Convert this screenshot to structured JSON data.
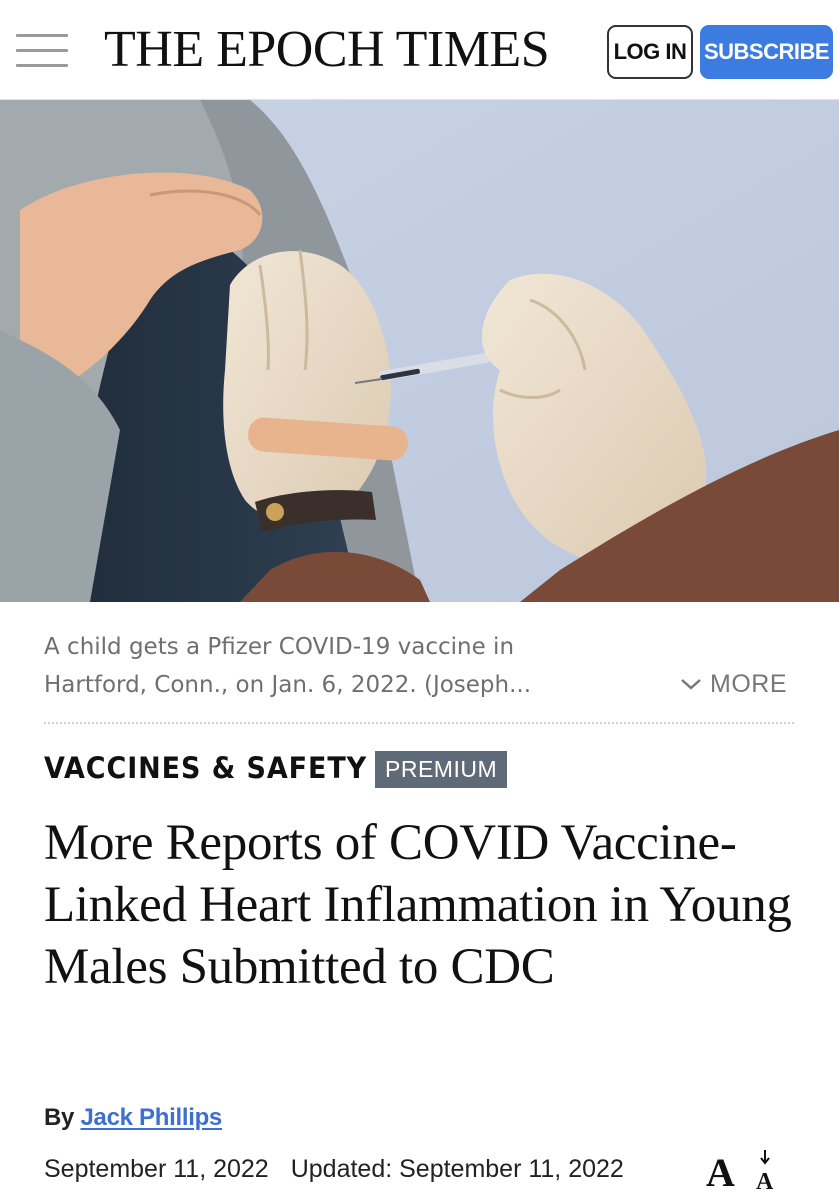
{
  "header": {
    "logo": "THE EPOCH TIMES",
    "login_label": "LOG IN",
    "subscribe_label": "SUBSCRIBE",
    "subscribe_color": "#3c7be0"
  },
  "photo": {
    "caption_line1": "A child gets a Pfizer COVID-19 vaccine in",
    "caption_line2": "Hartford, Conn., on Jan. 6, 2022. (Joseph...",
    "more_label": "MORE"
  },
  "article": {
    "section": "VACCINES & SAFETY",
    "badge": "PREMIUM",
    "headline": "More Reports of COVID Vaccine-Linked Heart Inflammation in Young Males Submitted to CDC",
    "byline_prefix": "By",
    "author": "Jack Phillips",
    "published": "September 11, 2022",
    "updated": "Updated: September 11, 2022"
  },
  "icons": [
    "menu-icon",
    "chevron-down-icon",
    "text-size-icon"
  ]
}
